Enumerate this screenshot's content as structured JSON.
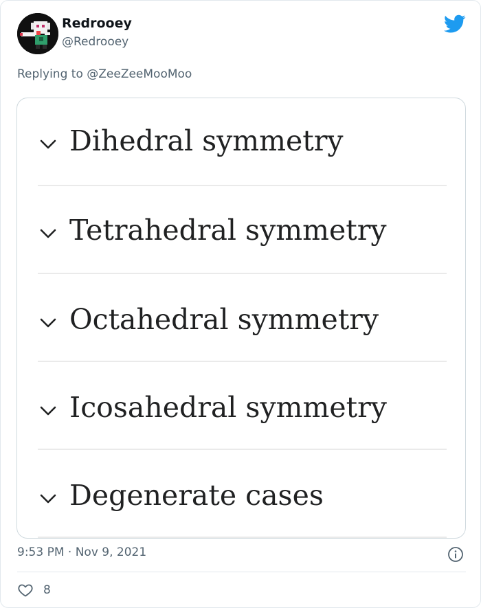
{
  "tweet": {
    "author_name": "Redrooey",
    "author_handle": "@Redrooey",
    "replying_prefix": "Replying to",
    "replying_to": "@ZeeZeeMooMoo",
    "timestamp": "9:53 PM · Nov 9, 2021",
    "like_count": "8",
    "colors": {
      "twitter_blue": "#1d9bf0",
      "muted": "#536471"
    }
  },
  "image": {
    "sections": [
      {
        "label": "Dihedral symmetry",
        "icon": "chevron-down-icon"
      },
      {
        "label": "Tetrahedral symmetry",
        "icon": "chevron-down-icon"
      },
      {
        "label": "Octahedral symmetry",
        "icon": "chevron-down-icon"
      },
      {
        "label": "Icosahedral symmetry",
        "icon": "chevron-down-icon"
      },
      {
        "label": "Degenerate cases",
        "icon": "chevron-down-icon"
      }
    ]
  }
}
